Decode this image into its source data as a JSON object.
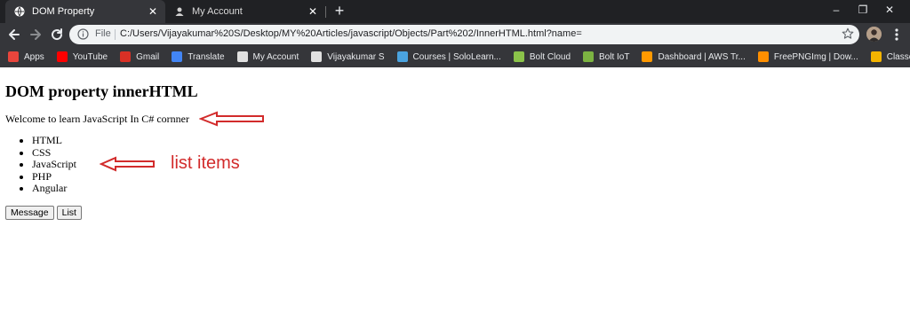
{
  "browser": {
    "tabs": [
      {
        "title": "DOM Property",
        "active": true
      },
      {
        "title": "My Account",
        "active": false
      }
    ],
    "new_tab": "+",
    "window_controls": {
      "minimize": "–",
      "restore": "❐",
      "close": "✕"
    },
    "address_bar": {
      "scheme_label": "File",
      "url": "C:/Users/Vijayakumar%20S/Desktop/MY%20Articles/javascript/Objects/Part%202/InnerHTML.html?name="
    },
    "bookmarks": [
      {
        "label": "Apps",
        "icon": "apps-grid-icon",
        "color": "#e8453c"
      },
      {
        "label": "YouTube",
        "icon": "youtube-icon",
        "color": "#ff0000"
      },
      {
        "label": "Gmail",
        "icon": "gmail-icon",
        "color": "#d93025"
      },
      {
        "label": "Translate",
        "icon": "translate-icon",
        "color": "#4285f4"
      },
      {
        "label": "My Account",
        "icon": "account-icon",
        "color": "#e0e0e0"
      },
      {
        "label": "Vijayakumar S",
        "icon": "account-icon",
        "color": "#e0e0e0"
      },
      {
        "label": "Courses | SoloLearn...",
        "icon": "sololearn-icon",
        "color": "#4aa3df"
      },
      {
        "label": "Bolt Cloud",
        "icon": "bolt-cloud-icon",
        "color": "#8bc34a"
      },
      {
        "label": "Bolt IoT",
        "icon": "bolt-iot-icon",
        "color": "#7cb342"
      },
      {
        "label": "Dashboard | AWS Tr...",
        "icon": "aws-icon",
        "color": "#ff9900"
      },
      {
        "label": "FreePNGImg | Dow...",
        "icon": "freepng-icon",
        "color": "#ff8f00"
      },
      {
        "label": "Classes",
        "icon": "classroom-icon",
        "color": "#f4b400"
      }
    ]
  },
  "page": {
    "heading": "DOM property innerHTML",
    "message": "Welcome to learn JavaScript In C# cornner",
    "list_items": [
      "HTML",
      "CSS",
      "JavaScript",
      "PHP",
      "Angular"
    ],
    "buttons": {
      "message": "Message",
      "list": "List"
    },
    "annotation": {
      "label": "list items",
      "color": "#d22b2b"
    }
  }
}
